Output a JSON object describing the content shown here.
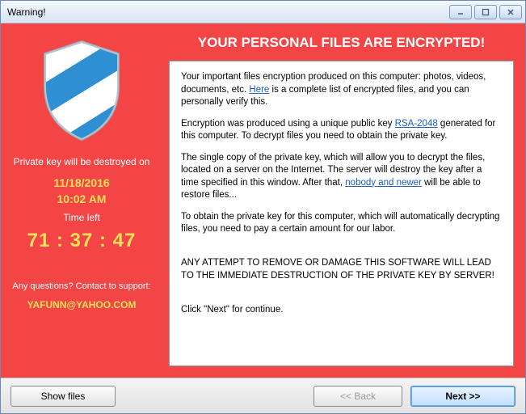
{
  "window": {
    "title": "Warning!"
  },
  "headline": "YOUR PERSONAL FILES ARE ENCRYPTED!",
  "left": {
    "destroy_label": "Private key will be destroyed on",
    "destroy_date": "11/18/2016",
    "destroy_time": "10:02 AM",
    "timeleft_label": "Time left",
    "countdown": "71 : 37 : 47",
    "support_label": "Any questions? Contact to support:",
    "support_email": "YAFUNN@YAHOO.COM"
  },
  "body": {
    "p1a": "Your important files encryption produced on this computer: photos, videos, documents, etc. ",
    "link_here": "Here",
    "p1b": " is a complete list of encrypted files, and you can personally verify this.",
    "p2a": "Encryption was produced using a unique public key ",
    "link_rsa": "RSA-2048",
    "p2b": " generated for this computer. To decrypt files you need to obtain the private key.",
    "p3a": "The single copy of the private key, which will allow you to decrypt the files, located on a server on the Internet. The server will destroy the key after a time specified in this window. After that, ",
    "link_nobody": "nobody and newer",
    "p3b": " will be able to restore files...",
    "p4": "To obtain the private key for this computer, which will automatically decrypting files, you need to pay a certain amount for our labor.",
    "p5": "ANY ATTEMPT TO REMOVE OR DAMAGE THIS SOFTWARE WILL LEAD TO THE IMMEDIATE DESTRUCTION OF THE PRIVATE KEY BY SERVER!",
    "p6": "Click \"Next\" for continue."
  },
  "buttons": {
    "show_files": "Show files",
    "back": "<< Back",
    "next": "Next >>"
  }
}
